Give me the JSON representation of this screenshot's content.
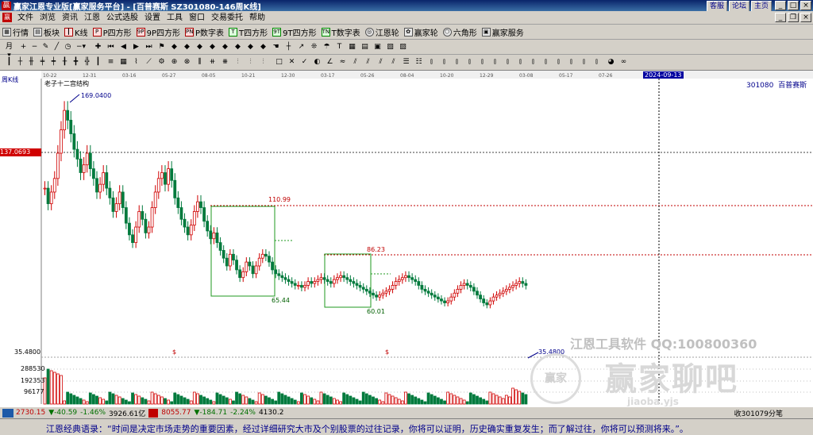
{
  "window": {
    "title": "赢家江恩专业版[赢家服务平台] - [百普赛斯  SZ301080-146周K线]",
    "links": [
      "客服",
      "论坛",
      "主页"
    ]
  },
  "menu": [
    "文件",
    "浏览",
    "资讯",
    "江恩",
    "公式选股",
    "设置",
    "工具",
    "窗口",
    "交易委托",
    "帮助"
  ],
  "toolbar1": [
    {
      "label": "行情",
      "icon": "grid-icon"
    },
    {
      "label": "板块",
      "icon": "blocks-icon"
    },
    {
      "label": "K线",
      "icon": "candle-icon"
    },
    {
      "label": "P四方形",
      "icon": "p-square-icon"
    },
    {
      "label": "9P四方形",
      "icon": "9p-square-icon"
    },
    {
      "label": "P数字表",
      "icon": "p-table-icon"
    },
    {
      "label": "T四方形",
      "icon": "t-square-icon"
    },
    {
      "label": "9T四方形",
      "icon": "9t-square-icon"
    },
    {
      "label": "T数字表",
      "icon": "t-table-icon"
    },
    {
      "label": "江恩轮",
      "icon": "wheel-icon"
    },
    {
      "label": "赢家轮",
      "icon": "winner-wheel-icon"
    },
    {
      "label": "六角形",
      "icon": "hexagon-icon"
    },
    {
      "label": "赢家服务",
      "icon": "service-icon"
    }
  ],
  "chart": {
    "period_label": "周K线",
    "indicator_label": "老子十二宫结构",
    "stock_code": "301080",
    "stock_name": "百普赛斯",
    "top_date_ticks": [
      "10-22",
      "12-31",
      "03-16",
      "05-27",
      "08-05",
      "10-21",
      "12-30",
      "03-17",
      "05-26",
      "08-04",
      "10-20",
      "12-29",
      "03-08",
      "05-17",
      "07-26"
    ],
    "cursor_date": "2024-09-13",
    "cursor_price": "137.0693",
    "high_label": "169.0400",
    "low_label": "35.4800",
    "level_110": "110.99",
    "level_86": "86.23",
    "level_65": "65.44",
    "level_60": "60.01",
    "axis_bottom_price": "35.4800",
    "volume_ticks": [
      "288530",
      "192353",
      "96177"
    ],
    "dividend_marks": [
      "$",
      "$"
    ],
    "watermark_line1": "江恩工具软件  QQ:100800360",
    "watermark_line2": "赢家聊吧",
    "watermark_logo_text": "赢家",
    "watermark_url": "jiaoba.yjs"
  },
  "chart_data": {
    "type": "candlestick",
    "ylim": [
      35.48,
      169.04
    ],
    "closes": [
      120,
      112,
      118,
      125,
      138,
      150,
      160,
      155,
      148,
      140,
      135,
      128,
      132,
      138,
      130,
      125,
      118,
      122,
      128,
      120,
      115,
      108,
      112,
      118,
      110,
      102,
      96,
      92,
      100,
      108,
      104,
      97,
      100,
      110,
      118,
      125,
      128,
      122,
      130,
      124,
      115,
      110,
      104,
      100,
      96,
      101,
      108,
      113,
      110,
      103,
      98,
      94,
      97,
      92,
      88,
      84,
      80,
      86,
      83,
      78,
      74,
      77,
      82,
      80,
      76,
      80,
      84,
      86,
      85,
      82,
      78,
      76,
      75,
      74,
      73,
      72,
      71,
      70,
      70,
      69,
      70,
      72,
      71,
      72,
      73,
      74,
      73,
      72,
      71,
      73,
      74,
      75,
      74,
      73,
      72,
      71,
      70,
      69,
      68,
      67,
      66,
      65,
      64,
      65,
      66,
      67,
      68,
      70,
      72,
      73,
      74,
      75,
      74,
      73,
      72,
      70,
      68,
      67,
      66,
      65,
      64,
      63,
      62,
      61,
      62,
      64,
      66,
      68,
      70,
      71,
      70,
      69,
      67,
      65,
      63,
      61,
      60,
      62,
      64,
      65,
      66,
      67,
      68,
      69,
      70,
      71,
      72,
      71,
      70
    ],
    "volume_max": 288530
  },
  "status": {
    "idx1": "2730.15",
    "idx1_chg": "▼-40.59",
    "idx1_pct": "-1.46%",
    "idx1_amt": "3926.61亿",
    "idx2": "8055.77",
    "idx2_chg": "▼-184.71",
    "idx2_pct": "-2.24%",
    "idx2_amt": "4130.2",
    "right_text": "收301079分笔"
  },
  "quote": "江恩经典语录：“时间是决定市场走势的重要因素，经过详细研究大市及个别股票的过往记录，你将可以证明，历史确实重复发生；而了解过往，你将可以预测将来。”。"
}
